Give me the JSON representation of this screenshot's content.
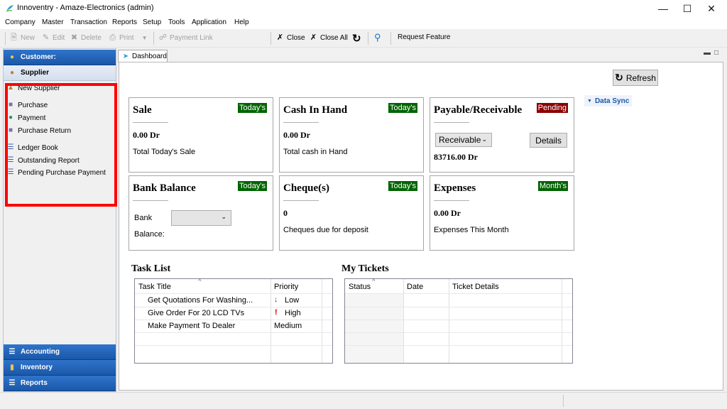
{
  "window": {
    "title": "Innoventry - Amaze-Electronics (admin)"
  },
  "menu": [
    "Company",
    "Master",
    "Transaction",
    "Reports",
    "Setup",
    "Tools",
    "Application",
    "Help"
  ],
  "toolbar": {
    "new": "New",
    "edit": "Edit",
    "delete": "Delete",
    "print": "Print",
    "payment_link": "Payment Link",
    "close": "Close",
    "close_all": "Close All",
    "request_feature": "Request Feature"
  },
  "sidebar": {
    "customer": "Customer:",
    "supplier": "Supplier",
    "items": [
      "New Supplier",
      "Purchase",
      "Payment",
      "Purchase Return",
      "Ledger Book",
      "Outstanding Report",
      "Pending Purchase Payment"
    ],
    "accounting": "Accounting",
    "inventory": "Inventory",
    "reports": "Reports"
  },
  "tab": {
    "dashboard": "Dashboard"
  },
  "dashboard": {
    "refresh": "Refresh",
    "data_sync": "Data Sync",
    "sale": {
      "title": "Sale",
      "badge": "Today's",
      "amount": "0.00 Dr",
      "desc": "Total Today's Sale"
    },
    "cash": {
      "title": "Cash In Hand",
      "badge": "Today's",
      "amount": "0.00 Dr",
      "desc": "Total cash in Hand"
    },
    "payable": {
      "title": "Payable/Receivable",
      "badge": "Pending",
      "select": "Receivable",
      "details": "Details",
      "amount": "83716.00 Dr"
    },
    "bank": {
      "title": "Bank Balance",
      "badge": "Today's",
      "bank_label": "Bank",
      "balance_label": "Balance:"
    },
    "cheque": {
      "title": "Cheque(s)",
      "badge": "Today's",
      "amount": "0",
      "desc": "Cheques due for deposit"
    },
    "expenses": {
      "title": "Expenses",
      "badge": "Month's",
      "amount": "0.00 Dr",
      "desc": "Expenses This Month"
    }
  },
  "task_list": {
    "title": "Task List",
    "columns": [
      "Task Title",
      "Priority"
    ],
    "rows": [
      {
        "title": "Get Quotations For Washing...",
        "priority": "Low"
      },
      {
        "title": "Give Order For 20 LCD TVs",
        "priority": "High"
      },
      {
        "title": "Make Payment To Dealer",
        "priority": "Medium"
      }
    ]
  },
  "tickets": {
    "title": "My Tickets",
    "columns": [
      "Status",
      "Date",
      "Ticket Details"
    ]
  },
  "colors": {
    "badge_green": "#006400",
    "badge_red": "#8b0000",
    "highlight": "#ff0000",
    "sidebar_blue": "#1b58a8"
  }
}
